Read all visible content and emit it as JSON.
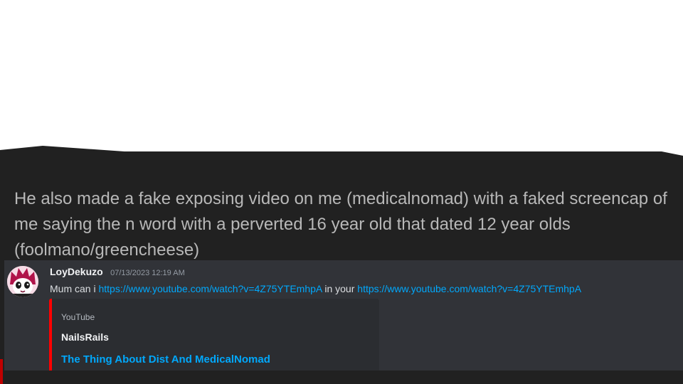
{
  "post": {
    "text": "He also made a fake exposing video on me (medicalnomad) with a faked screencap of me saying the n word with a perverted 16 year old that dated 12 year olds (foolmano/greencheese)"
  },
  "message": {
    "username": "LoyDekuzo",
    "timestamp": "07/13/2023 12:19 AM",
    "text_before": "Mum can i ",
    "link1": "https://www.youtube.com/watch?v=4Z75YTEmhpA",
    "text_middle": " in your ",
    "link2": "https://www.youtube.com/watch?v=4Z75YTEmhpA"
  },
  "embed": {
    "provider": "YouTube",
    "author": "NailsRails",
    "title": "The Thing About Dist And MedicalNomad",
    "accent_color": "#ff0000"
  },
  "colors": {
    "panel_bg": "#212121",
    "discord_bg": "#313338",
    "embed_bg": "#2b2d31",
    "link": "#00a8fc"
  }
}
